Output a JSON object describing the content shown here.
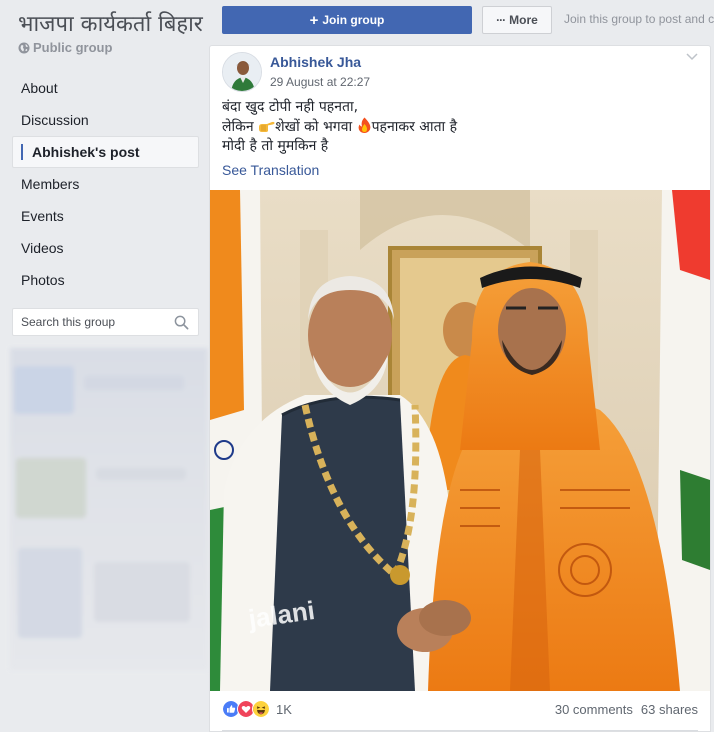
{
  "group": {
    "title": "भाजपा कार्यकर्ता बिहार",
    "type_label": "Public group"
  },
  "nav": {
    "items": [
      {
        "label": "About"
      },
      {
        "label": "Discussion"
      },
      {
        "label": "Abhishek's post",
        "active": true
      },
      {
        "label": "Members"
      },
      {
        "label": "Events"
      },
      {
        "label": "Videos"
      },
      {
        "label": "Photos"
      }
    ]
  },
  "search": {
    "placeholder": "Search this group",
    "icon": "search-icon"
  },
  "header": {
    "join_label": "Join group",
    "join_icon": "plus-icon",
    "more_label": "More",
    "more_icon": "ellipsis-icon",
    "join_hint": "Join this group to post and c"
  },
  "post": {
    "author": "Abhishek Jha",
    "timestamp": "29 August at 22:27",
    "text_lines": [
      {
        "parts": [
          "बंदा खुद टोपी नही पहनता,"
        ]
      },
      {
        "parts": [
          "लेकिन ",
          "शेखों को भगवा ",
          "पहनाकर आता है"
        ],
        "emojis": [
          "pointing-hand-emoji",
          "fire-emoji"
        ]
      },
      {
        "parts": [
          "मोदी है तो मुमकिन है"
        ]
      }
    ],
    "see_translation": "See Translation",
    "image_watermark": "jalani",
    "reactions": {
      "icons": [
        "like-icon",
        "love-icon",
        "haha-icon"
      ],
      "count": "1K"
    },
    "comments": "30 comments",
    "shares": "63 shares"
  },
  "colors": {
    "brand_blue": "#4267b2",
    "link_blue": "#385898",
    "page_bg": "#e9ebee",
    "saffron": "#f08a1c"
  }
}
